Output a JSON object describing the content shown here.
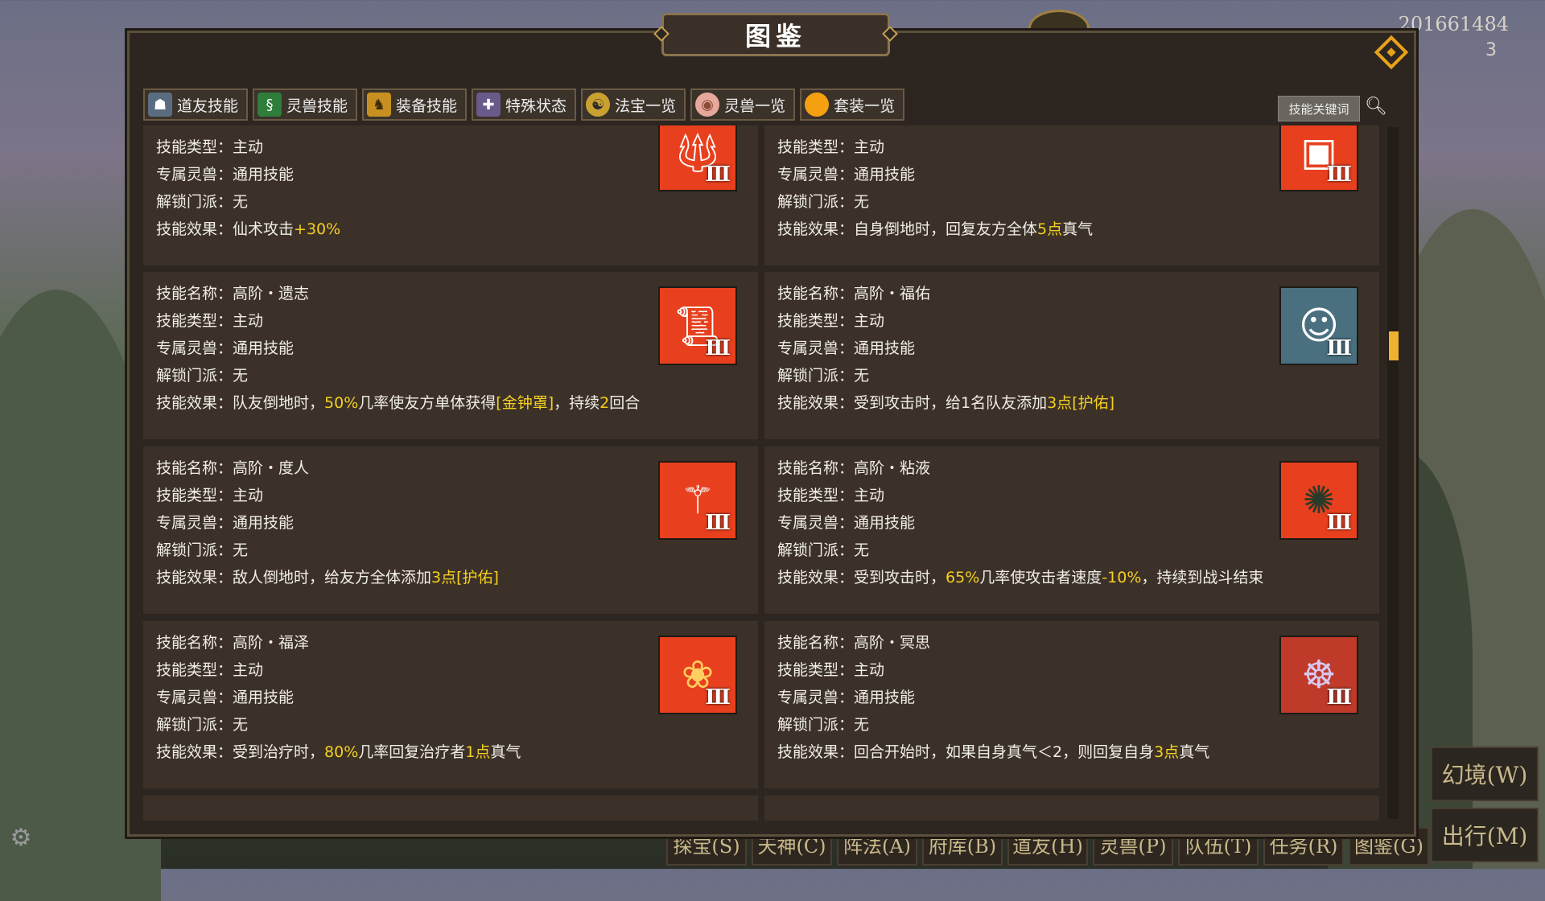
{
  "hud": {
    "top_right_number": "201661484",
    "top_right_number2": "3",
    "side_buttons": [
      "幻境(W)",
      "出行(M)"
    ],
    "bottom_buttons": [
      "探宝(S)",
      "天神(C)",
      "阵法(A)",
      "府库(B)",
      "道友(H)",
      "灵兽(P)",
      "队伍(T)",
      "任务(R)",
      "图鉴(G)"
    ]
  },
  "panel": {
    "title": "图鉴",
    "tabs": [
      {
        "label": "道友技能",
        "icon": "friend-skill-icon"
      },
      {
        "label": "灵兽技能",
        "icon": "beast-skill-icon"
      },
      {
        "label": "装备技能",
        "icon": "equipment-skill-icon"
      },
      {
        "label": "特殊状态",
        "icon": "special-status-icon"
      },
      {
        "label": "法宝一览",
        "icon": "treasure-icon"
      },
      {
        "label": "灵兽一览",
        "icon": "beast-egg-icon"
      },
      {
        "label": "套装一览",
        "icon": "set-orb-icon"
      }
    ],
    "keyword_button": "技能关键词",
    "field_labels": {
      "name": "技能名称：",
      "type": "技能类型：",
      "beast": "专属灵兽：",
      "sect": "解锁门派：",
      "effect": "技能效果："
    },
    "cards": [
      {
        "type": "主动",
        "beast": "通用技能",
        "sect": "无",
        "effect": [
          {
            "t": "仙术攻击"
          },
          {
            "t": "+30%",
            "hl": true
          }
        ],
        "icon": "trident-icon",
        "tier": "Ⅲ"
      },
      {
        "type": "主动",
        "beast": "通用技能",
        "sect": "无",
        "effect": [
          {
            "t": "自身倒地时，回复友方全体"
          },
          {
            "t": "5点",
            "hl": true
          },
          {
            "t": "真气"
          }
        ],
        "icon": "treasure-chest-icon",
        "tier": "Ⅲ"
      },
      {
        "name": "高阶・遗志",
        "type": "主动",
        "beast": "通用技能",
        "sect": "无",
        "effect": [
          {
            "t": "队友倒地时，"
          },
          {
            "t": "50%",
            "hl": true
          },
          {
            "t": "几率使友方单体获得"
          },
          {
            "t": "[金钟罩]",
            "hl": true
          },
          {
            "t": "，持续"
          },
          {
            "t": "2",
            "hl": true
          },
          {
            "t": "回合"
          }
        ],
        "icon": "scroll-icon",
        "tier": "Ⅲ"
      },
      {
        "name": "高阶・福佑",
        "type": "主动",
        "beast": "通用技能",
        "sect": "无",
        "effect": [
          {
            "t": "受到攻击时，给1名队友添加"
          },
          {
            "t": "3点[护佑]",
            "hl": true
          }
        ],
        "icon": "blessing-figure-icon",
        "tier": "Ⅲ"
      },
      {
        "name": "高阶・度人",
        "type": "主动",
        "beast": "通用技能",
        "sect": "无",
        "effect": [
          {
            "t": "敌人倒地时，给友方全体添加"
          },
          {
            "t": "3点[护佑]",
            "hl": true
          }
        ],
        "icon": "whisk-sage-icon",
        "tier": "Ⅲ"
      },
      {
        "name": "高阶・粘液",
        "type": "主动",
        "beast": "通用技能",
        "sect": "无",
        "effect": [
          {
            "t": "受到攻击时，"
          },
          {
            "t": "65%",
            "hl": true
          },
          {
            "t": "几率使攻击者速度"
          },
          {
            "t": "-10%",
            "hl": true
          },
          {
            "t": "，持续到战斗结束"
          }
        ],
        "icon": "slime-icon",
        "tier": "Ⅲ"
      },
      {
        "name": "高阶・福泽",
        "type": "主动",
        "beast": "通用技能",
        "sect": "无",
        "effect": [
          {
            "t": "受到治疗时，"
          },
          {
            "t": "80%",
            "hl": true
          },
          {
            "t": "几率回复治疗者"
          },
          {
            "t": "1点",
            "hl": true
          },
          {
            "t": "真气"
          }
        ],
        "icon": "lotus-icon",
        "tier": "Ⅲ"
      },
      {
        "name": "高阶・冥思",
        "type": "主动",
        "beast": "通用技能",
        "sect": "无",
        "effect": [
          {
            "t": "回合开始时，如果自身真气＜2，则回复自身"
          },
          {
            "t": "3点",
            "hl": true
          },
          {
            "t": "真气"
          }
        ],
        "icon": "meditation-icon",
        "tier": "Ⅲ"
      }
    ]
  }
}
